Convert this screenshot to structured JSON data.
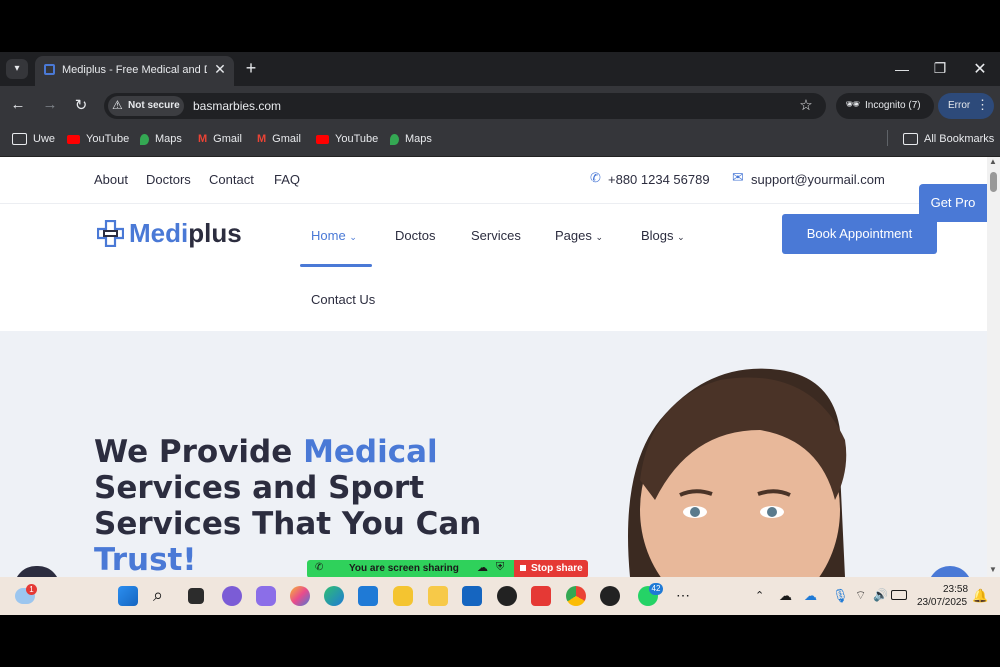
{
  "browser": {
    "tab_title": "Mediplus - Free Medical and Do",
    "new_tab": "+",
    "security_label": "Not secure",
    "url": "basmarbies.com",
    "incognito_label": "Incognito (7)",
    "error_label": "Error"
  },
  "bookmarks": [
    {
      "label": "Uwe",
      "icon": "folder-icon"
    },
    {
      "label": "YouTube",
      "icon": "youtube-icon"
    },
    {
      "label": "Maps",
      "icon": "maps-icon"
    },
    {
      "label": "Gmail",
      "icon": "gmail-icon"
    },
    {
      "label": "Gmail",
      "icon": "gmail-icon"
    },
    {
      "label": "YouTube",
      "icon": "youtube-icon"
    },
    {
      "label": "Maps",
      "icon": "maps-icon"
    }
  ],
  "all_bookmarks": "All Bookmarks",
  "site": {
    "top_links": [
      "About",
      "Doctors",
      "Contact",
      "FAQ"
    ],
    "phone": "+880 1234 56789",
    "email": "support@yourmail.com",
    "get_pro": "Get Pro",
    "logo_text_a": "Medi",
    "logo_text_b": "plus",
    "nav": [
      "Home",
      "Doctos",
      "Services",
      "Pages",
      "Blogs",
      "Contact Us"
    ],
    "book_button": "Book Appointment",
    "hero_line1_a": "We Provide ",
    "hero_line1_b": "Medical",
    "hero_line2": "Services and Sport",
    "hero_line3": "Services That You Can",
    "hero_line4": "Trust!"
  },
  "screen_share": {
    "label": "You are screen sharing",
    "stop": "Stop share"
  },
  "taskbar": {
    "weather_badge": "1",
    "whatsapp_badge": "42",
    "time": "23:58",
    "date": "23/07/2025"
  },
  "colors": {
    "accent": "#4a79d6",
    "heading": "#2c2d3f",
    "chrome_bg": "#35363a",
    "share_green": "#2fd15b",
    "share_red": "#e53935"
  }
}
